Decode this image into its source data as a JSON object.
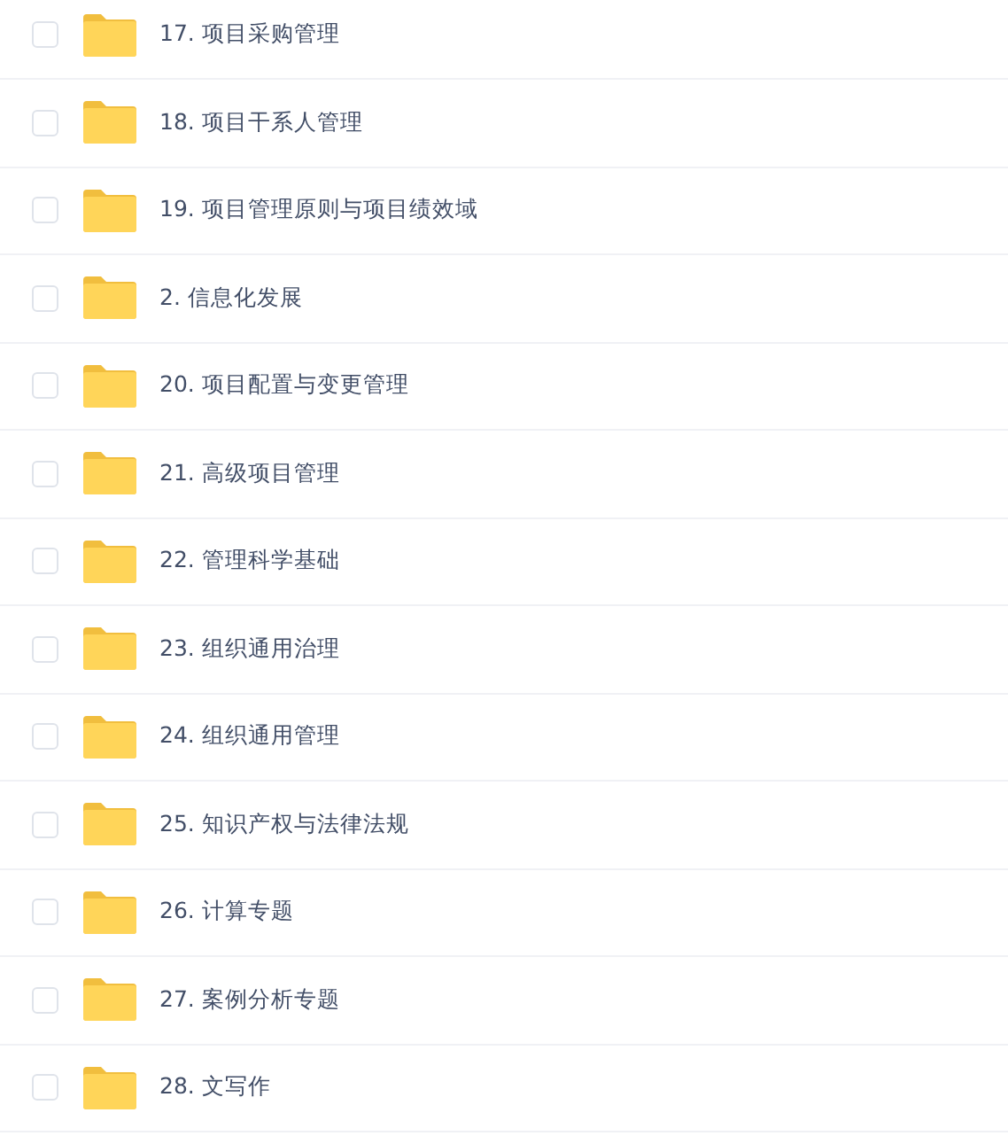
{
  "files": [
    {
      "name": "17. 项目采购管理",
      "checked": false
    },
    {
      "name": "18. 项目干系人管理",
      "checked": false
    },
    {
      "name": "19. 项目管理原则与项目绩效域",
      "checked": false
    },
    {
      "name": "2. 信息化发展",
      "checked": false
    },
    {
      "name": "20. 项目配置与变更管理",
      "checked": false
    },
    {
      "name": "21. 高级项目管理",
      "checked": false
    },
    {
      "name": "22. 管理科学基础",
      "checked": false
    },
    {
      "name": "23. 组织通用治理",
      "checked": false
    },
    {
      "name": "24. 组织通用管理",
      "checked": false
    },
    {
      "name": "25. 知识产权与法律法规",
      "checked": false
    },
    {
      "name": "26. 计算专题",
      "checked": false
    },
    {
      "name": "27. 案例分析专题",
      "checked": false
    },
    {
      "name": "28. 文写作",
      "checked": false
    }
  ]
}
